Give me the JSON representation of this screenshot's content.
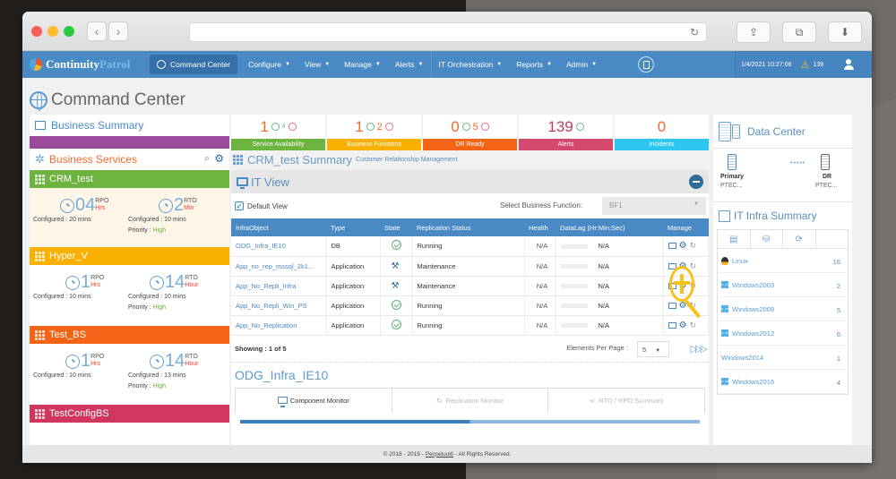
{
  "browser": {
    "back_label": "‹",
    "forward_label": "›",
    "reload_icon": "↻",
    "share_icon": "⇪",
    "tabs_icon": "⧉",
    "download_icon": "⬇"
  },
  "navbar": {
    "logo_part1": "Continuity",
    "logo_part2": "Patrol",
    "items": [
      {
        "label": "Command Center",
        "active": true
      },
      {
        "label": "Configure"
      },
      {
        "label": "View"
      },
      {
        "label": "Manage"
      },
      {
        "label": "Alerts"
      },
      {
        "label": "IT Orchestration"
      },
      {
        "label": "Reports"
      },
      {
        "label": "Admin"
      }
    ],
    "datetime": "1/4/2021 10:27:06",
    "alert_count": "139"
  },
  "page_title": "Command Center",
  "left": {
    "business_summary_title": "Business Summary",
    "business_services_title": "Business Services",
    "services": [
      {
        "name": "CRM_test",
        "color": "#6db33f",
        "bg": "#fdf6e8",
        "rpo_value": "04",
        "rpo_label": "RPO",
        "rpo_unit": "Hrs",
        "rto_value": "2",
        "rto_label": "RTO",
        "rto_unit": "Min",
        "rpo_configured": "Configured : 20 mins",
        "rto_configured": "Configured : 10 mins",
        "priority_label": "Priority :",
        "priority_value": "High"
      },
      {
        "name": "Hyper_V",
        "color": "#f9b000",
        "bg": "#ffffff",
        "rpo_value": "1",
        "rpo_label": "RPO",
        "rpo_unit": "Hrs",
        "rto_value": "14",
        "rto_label": "RTO",
        "rto_unit": "Hour",
        "rpo_configured": "Configured : 10 mins",
        "rto_configured": "Configured : 10 mins",
        "priority_label": "Priority :",
        "priority_value": "High"
      },
      {
        "name": "Test_BS",
        "color": "#f36516",
        "bg": "#ffffff",
        "rpo_value": "1",
        "rpo_label": "RPO",
        "rpo_unit": "Hrs",
        "rto_value": "14",
        "rto_label": "RTO",
        "rto_unit": "Hour",
        "rpo_configured": "Configured : 10 mins",
        "rto_configured": "Configured : 13 mins",
        "priority_label": "Priority :",
        "priority_value": "High"
      },
      {
        "name": "TestConfigBS",
        "color": "#d1365e"
      }
    ]
  },
  "stats": [
    {
      "value": "1",
      "sub_up": "",
      "sub_down": "4",
      "label": "Service Availability",
      "color": "#6db33f"
    },
    {
      "value": "1",
      "sub_up": "",
      "sub_down": "2",
      "label": "Business Functions",
      "color": "#f9b000"
    },
    {
      "value": "0",
      "sub_up": "",
      "sub_down": "5",
      "label": "DR Ready",
      "color": "#f36516"
    },
    {
      "value": "139",
      "label": "Alerts",
      "color": "#d4496f"
    },
    {
      "value": "0",
      "label": "Incidents",
      "color": "#2cc6f0"
    }
  ],
  "summary": {
    "title": "CRM_test Summary",
    "subtitle": "Customer Relationship Management"
  },
  "itview": {
    "title": "IT View",
    "default_view_label": "Default View",
    "default_view_checked": true,
    "select_label": "Select Business Function:",
    "select_value": "BF1",
    "columns": [
      "InfraObject",
      "Type",
      "State",
      "Replication Status",
      "Health",
      "DataLag (Hr:Min:Sec)",
      "Manage"
    ],
    "rows": [
      {
        "infra": "ODG_Infra_IE10",
        "type": "DB",
        "state": "ok",
        "status": "Running",
        "health": "N/A",
        "datalag": "N/A"
      },
      {
        "infra": "App_no_rep_mssql_2k1...",
        "type": "Application",
        "state": "maintenance",
        "status": "Maintenance",
        "health": "N/A",
        "datalag": "N/A"
      },
      {
        "infra": "App_No_Repli_Infra",
        "type": "Application",
        "state": "maintenance",
        "status": "Maintenance",
        "health": "N/A",
        "datalag": "N/A"
      },
      {
        "infra": "App_No_Repli_Win_PS",
        "type": "Application",
        "state": "ok",
        "status": "Running",
        "health": "N/A",
        "datalag": "N/A"
      },
      {
        "infra": "App_No_Replication",
        "type": "Application",
        "state": "ok",
        "status": "Running",
        "health": "N/A",
        "datalag": "N/A"
      }
    ],
    "showing": "Showing : 1 of 5",
    "per_page_label": "Elements Per Page :",
    "per_page_value": "5",
    "next_icon": "▷▷▷",
    "selected_infra": "ODG_Infra_IE10",
    "tabs": [
      {
        "label": "Component Monitor",
        "active": true
      },
      {
        "label": "Replication Monitor"
      },
      {
        "label": "RTO / RPO Summary"
      }
    ]
  },
  "datacenter": {
    "title": "Data Center",
    "primary_label": "Primary",
    "primary_sub": "PTEC...",
    "dr_label": "DR",
    "dr_sub": "PTEC..."
  },
  "infra_summary": {
    "title": "IT Infra Summary",
    "os": [
      {
        "name": "Linux",
        "count": "16",
        "icon": "linux"
      },
      {
        "name": "Windows2003",
        "count": "2",
        "icon": "windows"
      },
      {
        "name": "Windows2008",
        "count": "5",
        "icon": "windows"
      },
      {
        "name": "Windows2012",
        "count": "6",
        "icon": "windows"
      },
      {
        "name": "Windows2014",
        "count": "1",
        "icon": "none"
      },
      {
        "name": "Windows2016",
        "count": "4",
        "icon": "windows"
      }
    ]
  },
  "footer": {
    "prefix": "© 2018 - 2019 -",
    "link": "Perpetuuiti",
    "suffix": "- All Rights Reserved."
  }
}
